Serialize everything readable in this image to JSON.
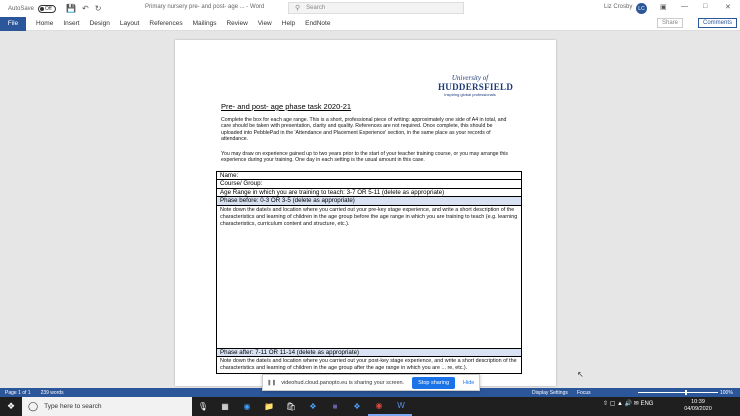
{
  "titlebar": {
    "autosave_label": "AutoSave",
    "toggle_state": "Off",
    "document_title": "Primary nursery pre- and post- age ... - Word",
    "search_placeholder": "Search",
    "user_name": "Liz Crosby",
    "user_initials": "LC"
  },
  "ribbon": {
    "file": "File",
    "tabs": [
      "Home",
      "Insert",
      "Design",
      "Layout",
      "References",
      "Mailings",
      "Review",
      "View",
      "Help",
      "EndNote"
    ],
    "share": "Share",
    "comments": "Comments"
  },
  "document": {
    "logo": {
      "line1": "University of",
      "line2": "HUDDERSFIELD",
      "line3": "Inspiring global professionals"
    },
    "heading": "Pre- and post- age phase task 2020-21",
    "para1": "Complete the box for each age range. This is a short, professional piece of writing: approximately one side of A4 in total, and care should be taken with presentation, clarity and quality. References are not required. Once complete, this should be uploaded into PebblePad in the 'Attendance and Placement Experience' section, in the same place as your records of attendance.",
    "para2": "You may draw on experience gained up to two years prior to the start of your teacher training course, or you may arrange this experience during your training. One day in each setting is the usual amount in this case.",
    "table": {
      "name": "Name:",
      "course": "Course/ Group:",
      "age_range": "Age Range in which you are training to teach:  3-7 OR 5-11 (delete as appropriate)",
      "phase_before": "Phase before: 0-3 OR 3-5 (delete as appropriate)",
      "before_desc": "Note down the date/s and location where you carried out your pre-key stage experience, and write a short description of the characteristics and learning of children in the age group before the age range in which you are training to teach (e.g. learning characteristics, curriculum content and structure, etc.).",
      "phase_after": "Phase after: 7-11 OR 11-14 (delete as appropriate)",
      "after_desc": "Note down the date/s and location where you carried out your post-key stage experience, and write a short description of the characteristics and learning of children in the age group after the age range in which you are ... re, etc.)."
    }
  },
  "statusbar": {
    "page": "Page 1 of 1",
    "words": "239 words",
    "display_settings": "Display Settings",
    "focus": "Focus",
    "zoom": "100%"
  },
  "share_popup": {
    "message": "videohud.cloud.panopto.eu is sharing your screen.",
    "stop": "Stop sharing",
    "hide": "Hide"
  },
  "taskbar": {
    "search_placeholder": "Type here to search",
    "time": "10:39",
    "date": "04/09/2020"
  }
}
